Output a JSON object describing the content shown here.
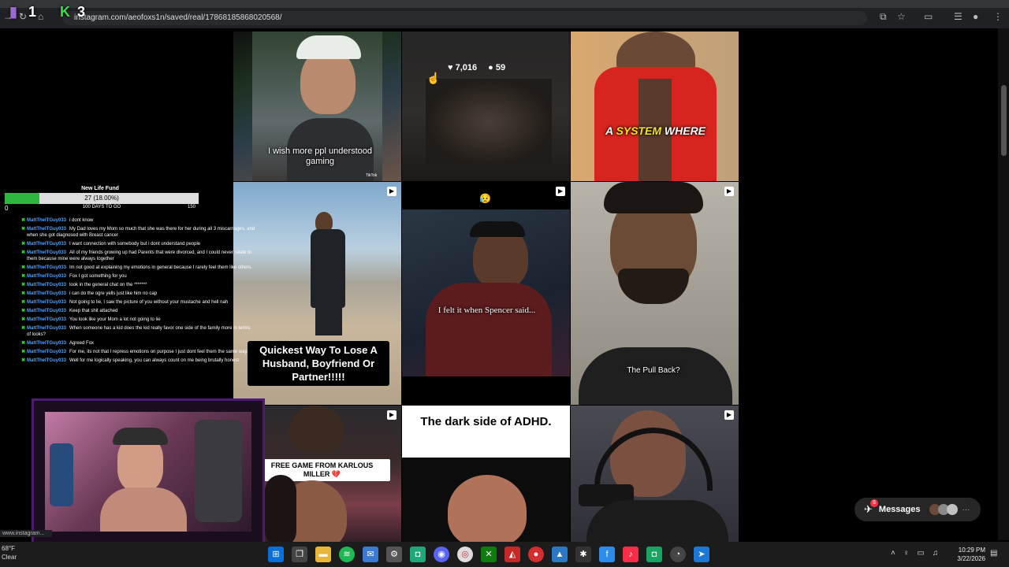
{
  "browser": {
    "url": "instagram.com/aeofoxs1n/saved/real/17868185868020568/",
    "overlay_left_number": "1",
    "overlay_right_number": "3",
    "status_url": "www.instagram..."
  },
  "grid": {
    "tile_2_stats": {
      "likes": "7,016",
      "comments": "59"
    },
    "tile_1_caption": "I wish more ppl understood gaming",
    "tile_1_brand": "TikTok",
    "tile_3_caption_a": "A",
    "tile_3_caption_b": "SYSTEM",
    "tile_3_caption_c": "WHERE",
    "tile_4_caption": "Quickest Way To Lose A Husband, Boyfriend Or Partner!!!!!",
    "tile_5_caption": "I felt it when Spencer said...",
    "tile_5_emoji": "😥",
    "tile_6_caption": "The Pull Back?",
    "tile_7_caption": "FREE GAME FROM KARLOUS MILLER 💔",
    "tile_8_caption": "The dark side of ADHD."
  },
  "fund": {
    "title": "New Life Fund",
    "amount": "27 (18.00%)",
    "min": "0",
    "max": "150",
    "days": "100 DAYS TO GO",
    "progress_fraction": 0.18
  },
  "chat": [
    {
      "user": "MattTheITGuy033",
      "text": "i dont know"
    },
    {
      "user": "MattTheITGuy033",
      "text": "My Dad loves my Mom so much that she was there for her during all 3 miscarriages, and when she got diagnosed with Breast cancer"
    },
    {
      "user": "MattTheITGuy033",
      "text": "I want connection with somebody but i dont understand people"
    },
    {
      "user": "MattTheITGuy033",
      "text": "All of my friends growing up had Parents that were divorced, and I could never relate to them because mine were always together"
    },
    {
      "user": "MattTheITGuy033",
      "text": "Im not good at explaining my emotions in general because I rarely feel them like others."
    },
    {
      "user": "MattTheITGuy033",
      "text": "Fox I got something for you"
    },
    {
      "user": "MattTheITGuy033",
      "text": "look in the general chat on the *******"
    },
    {
      "user": "MattTheITGuy033",
      "text": "i can do the ogre yells just like him no cap"
    },
    {
      "user": "MattTheITGuy033",
      "text": "Not going to lie, I saw the picture of you without your mustache and hell nah"
    },
    {
      "user": "MattTheITGuy033",
      "text": "Keep that shit attached"
    },
    {
      "user": "MattTheITGuy033",
      "text": "You look like your Mom a lot not going to lie"
    },
    {
      "user": "MattTheITGuy033",
      "text": "When someone has a kid does the kid really favor one side of the family more in terms of looks?"
    },
    {
      "user": "MattTheITGuy033",
      "text": "Agreed Fox"
    },
    {
      "user": "MattTheITGuy033",
      "text": "For me, its not that I repress emotions on purpose I just dont feel them the same way."
    },
    {
      "user": "MattTheITGuy033",
      "text": "Well for me logically speaking, you can always count on me being brutally honest"
    }
  ],
  "messages": {
    "label": "Messages",
    "badge": "8"
  },
  "taskbar": {
    "temp": "68°F",
    "weather": "Clear",
    "time": "10:29 PM",
    "date": "3/22/2026"
  },
  "icons": [
    "back-icon",
    "reload-icon",
    "home-icon",
    "bookmark-star-icon",
    "heart-icon",
    "comment-icon",
    "reel-icon",
    "messenger-icon",
    "windows-start-icon"
  ]
}
